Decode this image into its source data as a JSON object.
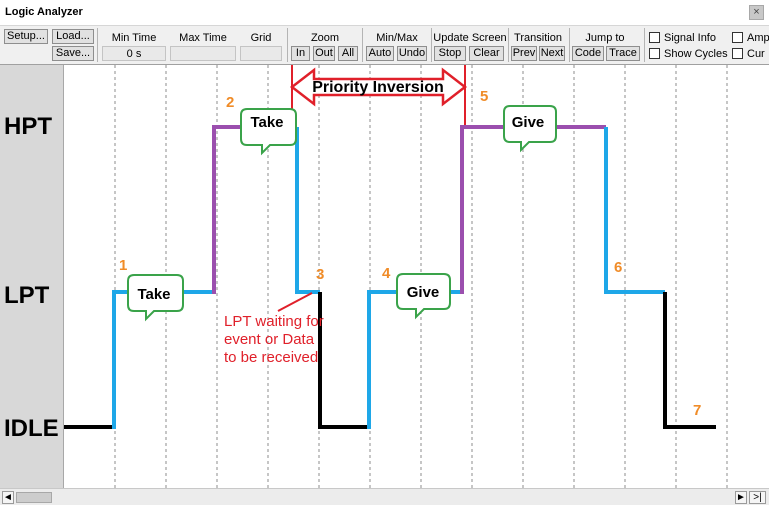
{
  "window": {
    "title": "Logic Analyzer",
    "close_label": "×"
  },
  "toolbar": {
    "setup_label": "Setup...",
    "load_label": "Load...",
    "save_label": "Save...",
    "min_time": {
      "label": "Min Time",
      "value": "0 s"
    },
    "max_time": {
      "label": "Max Time",
      "value": ""
    },
    "grid": {
      "label": "Grid",
      "value": ""
    },
    "zoom": {
      "label": "Zoom",
      "in": "In",
      "out": "Out",
      "all": "All"
    },
    "minmax": {
      "label": "Min/Max",
      "auto": "Auto",
      "undo": "Undo"
    },
    "update": {
      "label": "Update Screen",
      "stop": "Stop",
      "clear": "Clear"
    },
    "transition": {
      "label": "Transition",
      "prev": "Prev",
      "next": "Next"
    },
    "jump": {
      "label": "Jump to",
      "code": "Code",
      "trace": "Trace"
    },
    "signal_info": "Signal Info",
    "show_cycles": "Show Cycles",
    "amp": "Amp",
    "cur": "Cur"
  },
  "signals": [
    "HPT",
    "LPT",
    "IDLE"
  ],
  "annotations": {
    "priority_inversion": "Priority Inversion",
    "markers": [
      "1",
      "2",
      "3",
      "4",
      "5",
      "6",
      "7"
    ],
    "bubbles": [
      "Take",
      "Take",
      "Give",
      "Give"
    ],
    "lpt_waiting": [
      "LPT waiting for",
      "event or Data",
      "to be received"
    ]
  },
  "colors": {
    "lpt": "#1ea7e8",
    "hpt": "#9b4fae",
    "idle": "#000000",
    "marker": "#f08c28",
    "annotation": "#e0202a",
    "bubble_border": "#3aa34a"
  },
  "scrollbar": {
    "left": "◄",
    "right": "►",
    "end": ">|"
  }
}
